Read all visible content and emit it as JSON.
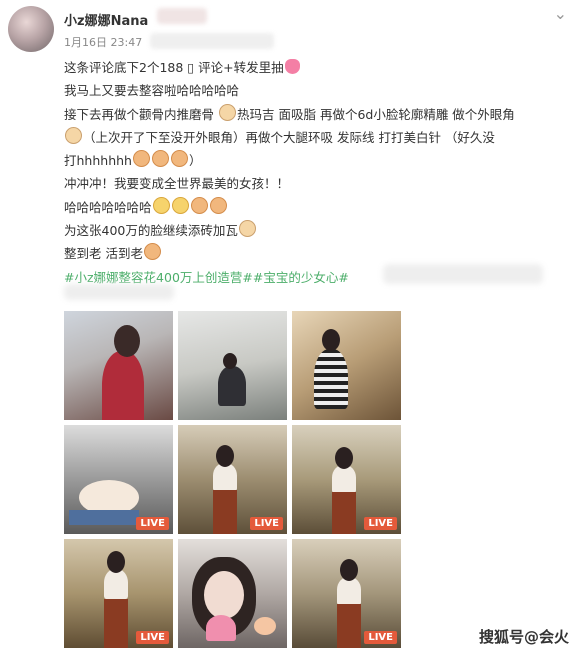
{
  "post": {
    "username": "小z娜娜Nana",
    "date": "1月16日 23:47",
    "lines": [
      "这条评论底下2个188 ▯ 评论+转发里抽",
      "我马上又要去整容啦哈哈哈哈哈",
      "接下去再做个颧骨内推磨骨",
      "热玛吉 面吸脂 再做个6d小脸轮廓精雕 做个外眼角",
      "（上次开了下至没开外眼角）再做个大腿环吸 发际线 打打美白针 （好久没",
      "打hhhhhhh",
      "冲冲冲！我要变成全世界最美的女孩！！",
      "哈哈哈哈哈哈哈",
      "为这张400万的脸继续添砖加瓦",
      "整到老 活到老"
    ],
    "topics": "#小z娜娜整容花400万上创造营##宝宝的少女心#",
    "live_label": "LIVE",
    "watermark": "搜狐号@会火"
  },
  "photos": [
    {
      "name": "photo-1",
      "live": false
    },
    {
      "name": "photo-2",
      "live": false
    },
    {
      "name": "photo-3",
      "live": false
    },
    {
      "name": "photo-4",
      "live": true
    },
    {
      "name": "photo-5",
      "live": true
    },
    {
      "name": "photo-6",
      "live": true
    },
    {
      "name": "photo-7",
      "live": true
    },
    {
      "name": "photo-8",
      "live": true
    },
    {
      "name": "photo-9",
      "live": true
    }
  ],
  "icons": {
    "more": "chevron-down-icon",
    "emoji_fist": "fist-emoji-icon",
    "emoji_cat": "cat-emoji-icon",
    "emoji_heart": "heart-emoji-icon"
  },
  "colors": {
    "topic": "#4cae6a",
    "live_badge": "#e45a3b"
  }
}
